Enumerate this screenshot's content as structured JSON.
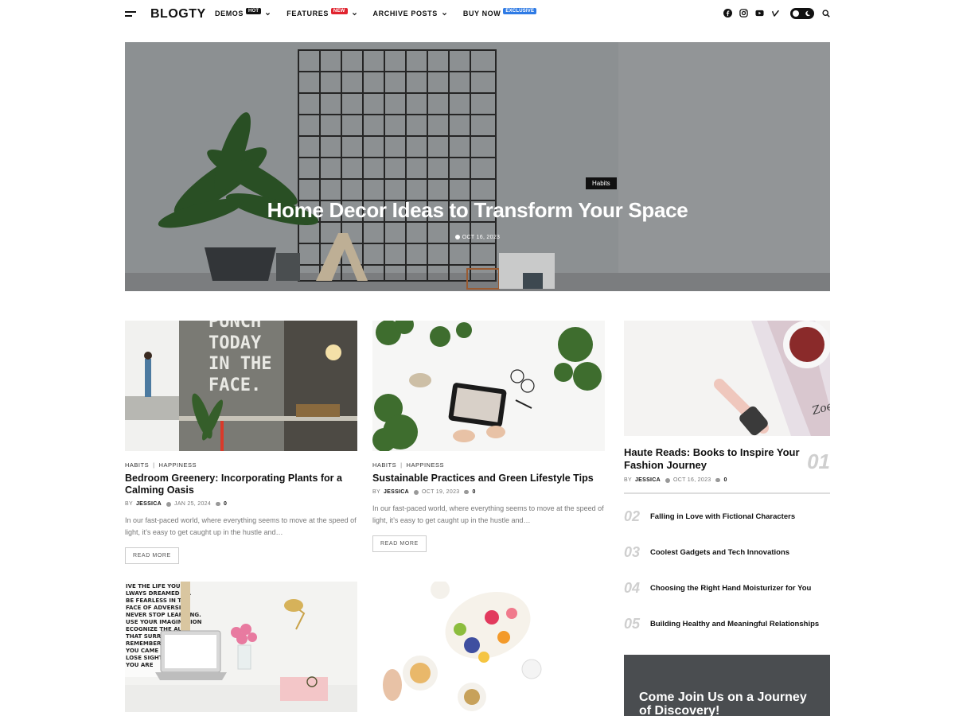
{
  "header": {
    "logo": "BLOGTY",
    "nav": [
      {
        "label": "DEMOS",
        "badge": "HOT"
      },
      {
        "label": "FEATURES",
        "badge": "NEW"
      },
      {
        "label": "ARCHIVE POSTS",
        "badge": ""
      },
      {
        "label": "BUY NOW",
        "badge": "EXCLUSIVE"
      }
    ],
    "social_icons": [
      "facebook-icon",
      "instagram-icon",
      "youtube-icon",
      "vimeo-icon"
    ]
  },
  "hero": {
    "category": "Habits",
    "title": "Home Decor Ideas to Transform Your Space",
    "date": "OCT 16, 2023"
  },
  "posts": [
    {
      "cat1": "HABITS",
      "cat2": "HAPPINESS",
      "title": "Bedroom Greenery: Incorporating Plants for a Calming Oasis",
      "by": "BY",
      "author": "JESSICA",
      "date": "JAN 25, 2024",
      "comments": "0",
      "excerpt": "In our fast-paced world, where everything seems to move at the speed of light, it’s easy to get caught up in the hustle and…",
      "read_more": "READ MORE"
    },
    {
      "cat1": "HABITS",
      "cat2": "HAPPINESS",
      "title": "Sustainable Practices and Green Lifestyle Tips",
      "by": "BY",
      "author": "JESSICA",
      "date": "OCT 19, 2023",
      "comments": "0",
      "excerpt": "In our fast-paced world, where everything seems to move at the speed of light, it’s easy to get caught up in the hustle and…",
      "read_more": "READ MORE"
    }
  ],
  "sidebar": {
    "featured": {
      "title": "Haute Reads: Books to Inspire Your Fashion Journey",
      "num": "01",
      "by": "BY",
      "author": "JESSICA",
      "date": "OCT 16, 2023",
      "comments": "0"
    },
    "list": [
      {
        "num": "02",
        "title": "Falling in Love with Fictional Characters"
      },
      {
        "num": "03",
        "title": "Coolest Gadgets and Tech Innovations"
      },
      {
        "num": "04",
        "title": "Choosing the Right Hand Moisturizer for You"
      },
      {
        "num": "05",
        "title": "Building Healthy and Meaningful Relationships"
      }
    ],
    "newsletter_title": "Come Join Us on a Journey of Discovery!"
  }
}
